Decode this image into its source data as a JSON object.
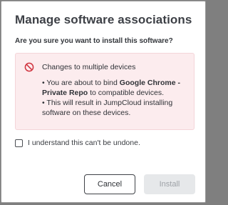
{
  "dialog": {
    "title": "Manage software associations",
    "question": "Are you sure you want to install this software?",
    "alert": {
      "icon": "prohibited-icon",
      "heading": "Changes to multiple devices",
      "line1_prefix": "• You are about to bind ",
      "line1_bold": "Google Chrome - Private Repo",
      "line1_suffix": " to compatible devices.",
      "line2": "• This will result in JumpCloud installing software on these devices."
    },
    "checkbox": {
      "label": "I understand this can't be undone.",
      "checked": false
    },
    "buttons": {
      "cancel": "Cancel",
      "install": "Install",
      "install_disabled": true
    }
  },
  "colors": {
    "alert_bg": "#fcecee",
    "alert_icon": "#d0343f",
    "disabled_bg": "#e6e8ea"
  }
}
